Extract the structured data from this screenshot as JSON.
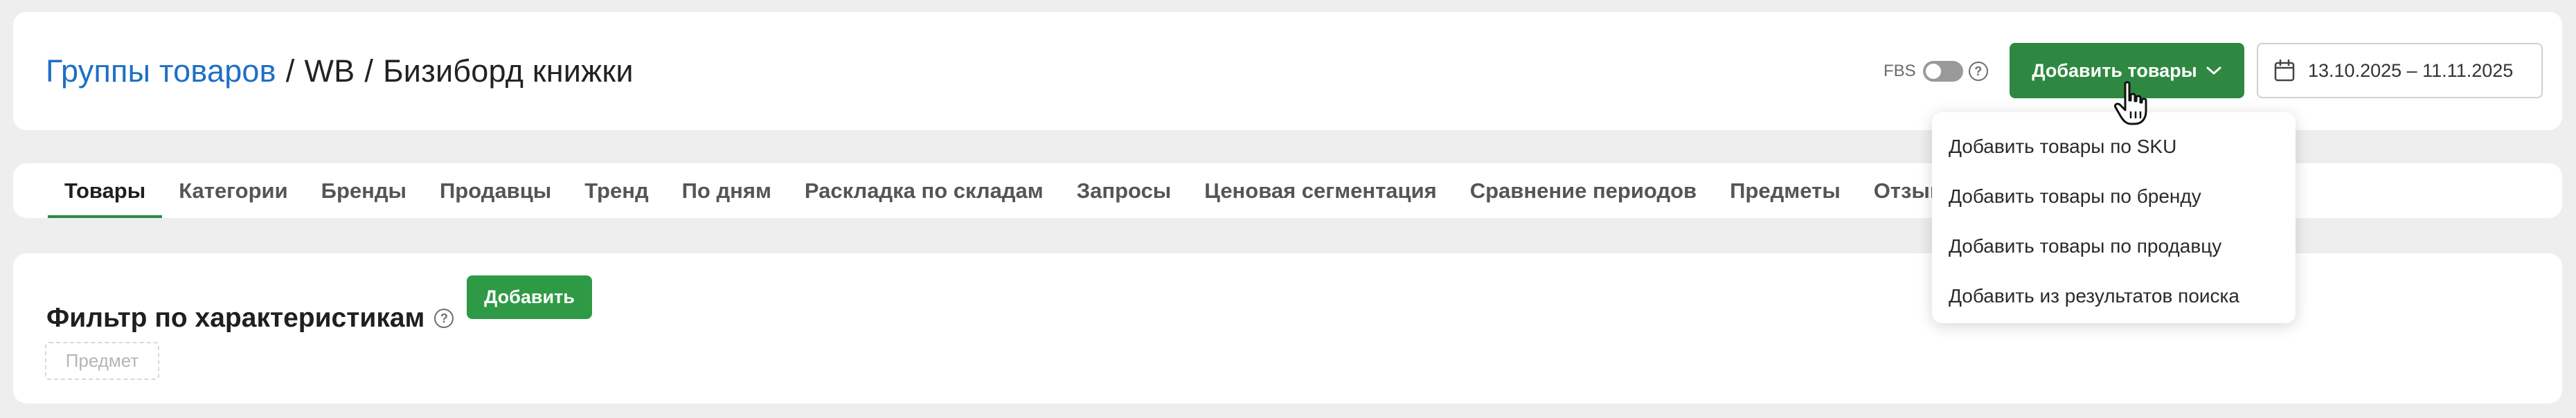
{
  "header": {
    "breadcrumb": {
      "root": "Группы товаров",
      "separator1": "/",
      "level1": "WB",
      "separator2": "/",
      "current": "Бизиборд книжки"
    },
    "fbs": {
      "label": "FBS",
      "enabled": false
    },
    "add_button_label": "Добавить товары",
    "date_range": "13.10.2025 – 11.11.2025"
  },
  "add_menu": {
    "items": [
      "Добавить товары по SKU",
      "Добавить товары по бренду",
      "Добавить товары по продавцу",
      "Добавить из результатов поиска"
    ]
  },
  "tabs": {
    "active_index": 0,
    "items": [
      "Товары",
      "Категории",
      "Бренды",
      "Продавцы",
      "Тренд",
      "По дням",
      "Раскладка по складам",
      "Запросы",
      "Ценовая сегментация",
      "Сравнение периодов",
      "Предметы",
      "Отзывы"
    ]
  },
  "filter": {
    "title": "Фильтр по характеристикам",
    "add_label": "Добавить",
    "chip_placeholder": "Предмет"
  },
  "colors": {
    "accent_green": "#2f8841",
    "link_blue": "#1f6fc5",
    "background": "#eeeeee"
  },
  "icons": [
    "help-icon",
    "chevron-down-icon",
    "calendar-icon",
    "hand-pointer-icon"
  ]
}
